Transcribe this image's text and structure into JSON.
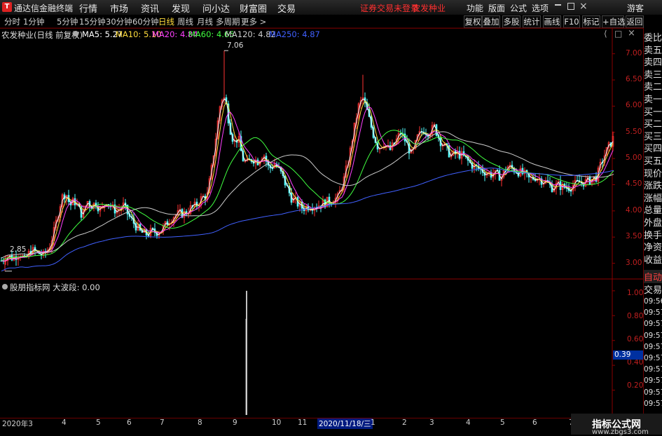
{
  "menubar": {
    "app_title": "通达信金融终端",
    "items": [
      "行情",
      "市场",
      "资讯",
      "发现",
      "问小达",
      "财富圈",
      "交易"
    ],
    "notice": "证券交易未登录",
    "stock": "农发种业",
    "right_items": [
      "功能",
      "版面",
      "公式",
      "选项"
    ],
    "guest": "游客"
  },
  "toolbar": {
    "periods": [
      "分时",
      "1分钟",
      "5分钟",
      "15分钟",
      "30分钟",
      "60分钟",
      "日线",
      "周线",
      "月线",
      "多周期",
      "更多 >"
    ],
    "active_period": "日线",
    "right_buttons": [
      "复权",
      "叠加",
      "多股",
      "统计",
      "画线",
      "F10",
      "标记",
      "+自选",
      "返回"
    ]
  },
  "main_chart": {
    "title": "农发种业(日线 前复权)",
    "ma": [
      {
        "label": "MA5: 5.27",
        "color": "#ffffff"
      },
      {
        "label": "MA10: 5.10",
        "color": "#ffdc3c"
      },
      {
        "label": "MA20: 4.84",
        "color": "#ff40ff"
      },
      {
        "label": "MA60: 4.65",
        "color": "#40ff40"
      },
      {
        "label": "MA120: 4.82",
        "color": "#cccccc"
      },
      {
        "label": "MA250: 4.87",
        "color": "#4060ff"
      }
    ],
    "high_label": "7.06",
    "low_label": "2.85",
    "y_ticks": [
      "7.00",
      "6.50",
      "6.00",
      "5.50",
      "5.00",
      "4.50",
      "4.00",
      "3.50",
      "3.00"
    ]
  },
  "indicator": {
    "title": "股朋指标网  大波段: 0.00",
    "y_ticks": [
      "1.00",
      "0.80",
      "0.60",
      "0.40",
      "0.20"
    ],
    "cursor_value": "0.39"
  },
  "side_panel": {
    "items": [
      "委比",
      "卖五",
      "卖四",
      "卖三",
      "卖二",
      "卖一",
      "买一",
      "买二",
      "买三",
      "买四",
      "买五",
      "现价",
      "涨跌",
      "涨幅",
      "总量",
      "外盘",
      "换手",
      "净资",
      "收益"
    ],
    "auto": "自动",
    "trade": "交易",
    "times": [
      "09:56",
      "09:57",
      "09:57",
      "09:57",
      "09:57",
      "09:57",
      "09:57",
      "09:57",
      "09:57",
      "09:57"
    ]
  },
  "x_axis": {
    "labels": [
      "2020年3",
      "4",
      "5",
      "6",
      "7",
      "8",
      "9",
      "10",
      "11",
      "2020/11/18/三",
      "1",
      "2",
      "3",
      "4",
      "5",
      "6",
      "7"
    ]
  },
  "watermark": {
    "title": "指标公式网",
    "url": "www.zbgs3.com"
  },
  "chart_data": {
    "type": "candlestick",
    "ylim": [
      2.7,
      7.25
    ],
    "ma_colors": {
      "ma5": "#ffffff",
      "ma10": "#ffdc3c",
      "ma20": "#ff40ff",
      "ma60": "#40ff40",
      "ma120": "#cccccc",
      "ma250": "#4060ff"
    },
    "anchors": [
      [
        0,
        3.05
      ],
      [
        8,
        3.15
      ],
      [
        16,
        3.1
      ],
      [
        26,
        3.2
      ],
      [
        33,
        3.05
      ],
      [
        42,
        3.25
      ],
      [
        52,
        3.2
      ],
      [
        60,
        3.15
      ],
      [
        68,
        3.3
      ],
      [
        75,
        3.6
      ],
      [
        80,
        3.9
      ],
      [
        86,
        4.25
      ],
      [
        92,
        4.35
      ],
      [
        98,
        4.1
      ],
      [
        104,
        4.2
      ],
      [
        110,
        4.05
      ],
      [
        116,
        3.9
      ],
      [
        122,
        4.2
      ],
      [
        128,
        4.1
      ],
      [
        135,
        4.15
      ],
      [
        142,
        4.0
      ],
      [
        150,
        4.2
      ],
      [
        158,
        4.05
      ],
      [
        166,
        4.0
      ],
      [
        174,
        4.1
      ],
      [
        182,
        3.9
      ],
      [
        190,
        3.75
      ],
      [
        198,
        3.6
      ],
      [
        206,
        3.55
      ],
      [
        214,
        3.6
      ],
      [
        222,
        3.6
      ],
      [
        230,
        3.65
      ],
      [
        238,
        3.8
      ],
      [
        246,
        3.9
      ],
      [
        254,
        3.95
      ],
      [
        262,
        3.95
      ],
      [
        270,
        4.05
      ],
      [
        278,
        4.1
      ],
      [
        286,
        4.25
      ],
      [
        294,
        4.3
      ],
      [
        300,
        4.8
      ],
      [
        306,
        5.4
      ],
      [
        312,
        6.0
      ],
      [
        316,
        6.2
      ],
      [
        320,
        6.1
      ],
      [
        326,
        5.6
      ],
      [
        332,
        5.3
      ],
      [
        338,
        5.4
      ],
      [
        344,
        5.0
      ],
      [
        350,
        4.9
      ],
      [
        358,
        5.0
      ],
      [
        366,
        4.95
      ],
      [
        374,
        5.1
      ],
      [
        382,
        4.8
      ],
      [
        390,
        4.9
      ],
      [
        398,
        4.75
      ],
      [
        406,
        4.5
      ],
      [
        414,
        4.25
      ],
      [
        422,
        4.15
      ],
      [
        430,
        4.05
      ],
      [
        440,
        4.1
      ],
      [
        450,
        4.1
      ],
      [
        460,
        4.15
      ],
      [
        470,
        4.2
      ],
      [
        480,
        4.25
      ],
      [
        488,
        4.55
      ],
      [
        496,
        5.0
      ],
      [
        504,
        5.6
      ],
      [
        510,
        6.0
      ],
      [
        516,
        6.15
      ],
      [
        522,
        5.9
      ],
      [
        530,
        5.5
      ],
      [
        538,
        5.2
      ],
      [
        546,
        5.3
      ],
      [
        554,
        5.15
      ],
      [
        562,
        5.3
      ],
      [
        570,
        5.5
      ],
      [
        578,
        5.3
      ],
      [
        586,
        5.05
      ],
      [
        594,
        5.4
      ],
      [
        602,
        5.55
      ],
      [
        610,
        5.5
      ],
      [
        618,
        5.6
      ],
      [
        626,
        5.35
      ],
      [
        634,
        5.2
      ],
      [
        642,
        5.05
      ],
      [
        650,
        5.1
      ],
      [
        658,
        5.05
      ],
      [
        666,
        4.95
      ],
      [
        674,
        4.85
      ],
      [
        682,
        4.8
      ],
      [
        690,
        4.75
      ],
      [
        698,
        4.7
      ],
      [
        706,
        4.7
      ],
      [
        714,
        4.65
      ],
      [
        722,
        4.85
      ],
      [
        730,
        4.8
      ],
      [
        738,
        4.75
      ],
      [
        746,
        4.7
      ],
      [
        754,
        4.6
      ],
      [
        762,
        4.65
      ],
      [
        770,
        4.6
      ],
      [
        778,
        4.55
      ],
      [
        786,
        4.45
      ],
      [
        794,
        4.5
      ],
      [
        802,
        4.45
      ],
      [
        810,
        4.45
      ],
      [
        818,
        4.5
      ],
      [
        826,
        4.55
      ],
      [
        834,
        4.55
      ],
      [
        842,
        4.6
      ],
      [
        850,
        4.65
      ],
      [
        856,
        4.9
      ],
      [
        862,
        5.1
      ],
      [
        868,
        5.25
      ],
      [
        874,
        5.4
      ]
    ],
    "spikes": [
      [
        318,
        7.06
      ],
      [
        516,
        6.6
      ],
      [
        5,
        2.85
      ]
    ],
    "indicator_spike": {
      "index_x": 350,
      "value": 1.0
    },
    "ind_ylim": [
      0,
      1.05
    ]
  }
}
